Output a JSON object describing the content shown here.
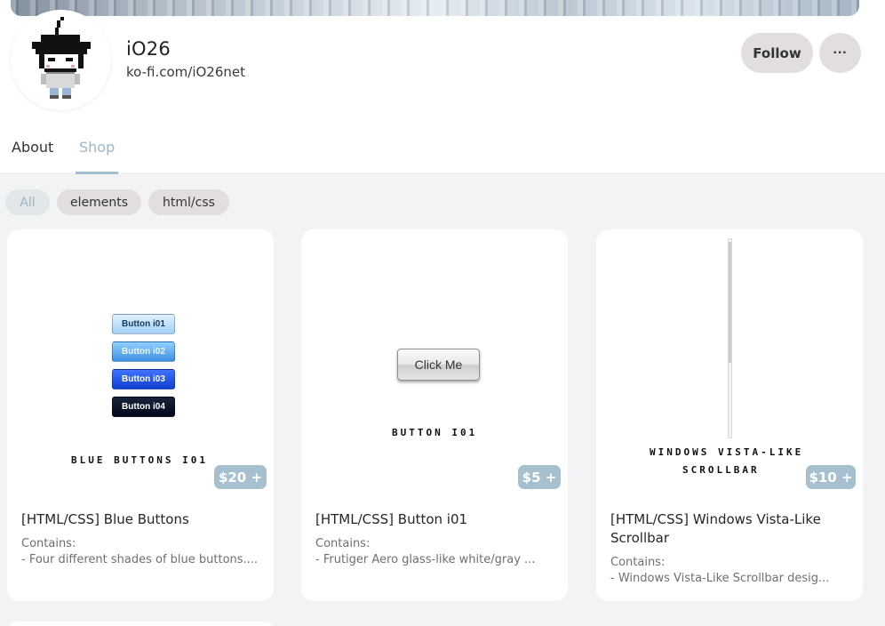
{
  "profile": {
    "name": "iO26",
    "url": "ko-fi.com/iO26net",
    "follow_label": "Follow",
    "more_label": "···"
  },
  "tabs": [
    {
      "label": "About",
      "active": false
    },
    {
      "label": "Shop",
      "active": true
    }
  ],
  "filters": [
    {
      "label": "All",
      "active": true
    },
    {
      "label": "elements",
      "active": false
    },
    {
      "label": "html/css",
      "active": false
    }
  ],
  "products": [
    {
      "title": "[HTML/CSS] Blue Buttons",
      "price": "$20 +",
      "contains_label": "Contains:",
      "description": "- Four different shades of blue buttons....",
      "preview": {
        "buttons": [
          "Button i01",
          "Button i02",
          "Button i03",
          "Button i04"
        ],
        "caption": "Blue Buttons i01"
      }
    },
    {
      "title": "[HTML/CSS] Button i01",
      "price": "$5 +",
      "contains_label": "Contains:",
      "description": "- Frutiger Aero glass-like white/gray ...",
      "preview": {
        "button": "Click Me",
        "caption": "Button i01"
      }
    },
    {
      "title": "[HTML/CSS] Windows Vista-Like Scrollbar",
      "price": "$10 +",
      "contains_label": "Contains:",
      "description": "- Windows Vista-Like Scrollbar desig...",
      "preview": {
        "caption_line1": "Windows Vista-Like",
        "caption_line2": "Scrollbar"
      }
    }
  ],
  "colors": {
    "accent": "#a6c0cf",
    "chip": "#e3dede",
    "page_bg": "#f1f3f5"
  }
}
